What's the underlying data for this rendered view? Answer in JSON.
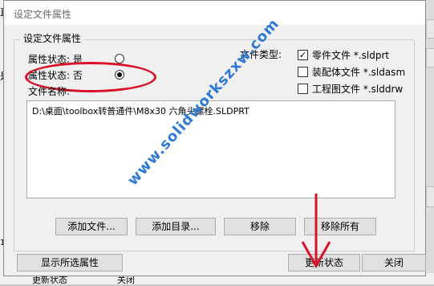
{
  "background": {
    "left_chars": [
      "直",
      "是",
      "1"
    ],
    "bottom_labels": [
      "更新状态",
      "关闭"
    ]
  },
  "dialog": {
    "title": "设定文件属性",
    "group_title": "设定文件属性",
    "property_state_yes": "属性状态: 是",
    "property_state_no": "属性状态: 否",
    "property_state_selected": "no",
    "file_name_label": "文件名称:",
    "file_type_label": "文件类型:",
    "file_types": [
      {
        "label": "零件文件 *.sldprt",
        "checked": true
      },
      {
        "label": "装配体文件 *.sldasm",
        "checked": false
      },
      {
        "label": "工程图文件 *.slddrw",
        "checked": false
      }
    ],
    "files": [
      "D:\\桌面\\toolbox转普通件\\M8x30 六角头螺栓.SLDPRT"
    ],
    "buttons": {
      "add_file": "添加文件...",
      "add_folder": "添加目录...",
      "remove": "移除",
      "remove_all": "移除所有",
      "show_selected": "显示所选属性",
      "update_state": "更新状态",
      "close": "关闭"
    }
  },
  "watermark": "www.solidworkszxw.com",
  "colors": {
    "annotation": "#d9112a",
    "watermark": "#2f79d6"
  }
}
